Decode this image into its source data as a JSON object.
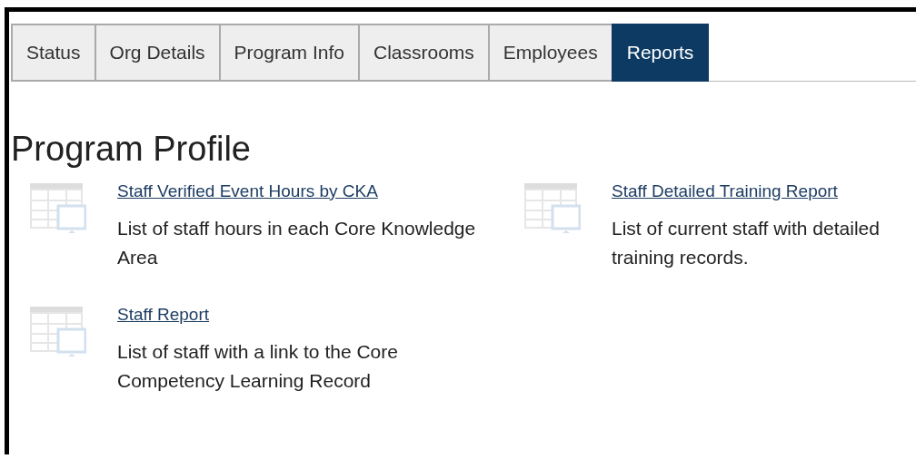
{
  "tabs": [
    {
      "label": "Status",
      "selected": false
    },
    {
      "label": "Org Details",
      "selected": false
    },
    {
      "label": "Program Info",
      "selected": false
    },
    {
      "label": "Classrooms",
      "selected": false
    },
    {
      "label": "Employees",
      "selected": false
    },
    {
      "label": "Reports",
      "selected": true
    }
  ],
  "heading": "Program Profile",
  "reports": [
    {
      "title": "Staff Verified Event Hours by CKA",
      "description": "List of staff hours in each Core Knowledge Area"
    },
    {
      "title": "Staff Detailed Training Report",
      "description": "List of current staff with detailed training records."
    },
    {
      "title": "Staff Report",
      "description": "List of staff with a link to the Core Competency Learning Record"
    }
  ]
}
